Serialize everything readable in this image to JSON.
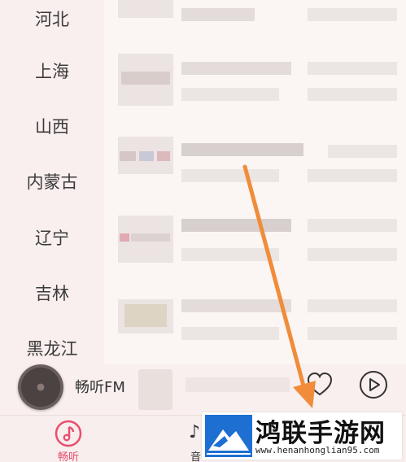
{
  "sidebar": {
    "provinces": [
      "河北",
      "上海",
      "山西",
      "内蒙古",
      "辽宁",
      "吉林",
      "黑龙江"
    ]
  },
  "player": {
    "title": "畅听FM",
    "icons": [
      "disc-cover",
      "heart-icon",
      "play-icon"
    ]
  },
  "tabbar": {
    "tabs": [
      {
        "label": "畅听",
        "icon": "music-note-icon",
        "active": true,
        "color": "#e94d6d"
      },
      {
        "label": "音",
        "icon": "music-note-icon",
        "active": false
      }
    ]
  },
  "annotation": {
    "arrow_color": "#f08c3a"
  },
  "watermark": {
    "title": "鸿联手游网",
    "url": "www.henanhonglian95.com"
  }
}
